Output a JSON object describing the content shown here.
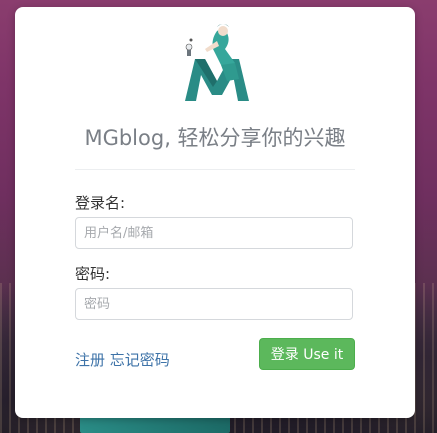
{
  "brand": {
    "tagline": "MGblog, 轻松分享你的兴趣"
  },
  "form": {
    "username_label": "登录名:",
    "username_placeholder": "用户名/邮箱",
    "username_value": "",
    "password_label": "密码:",
    "password_placeholder": "密码",
    "password_value": ""
  },
  "links": {
    "register": "注册",
    "forgot": "忘记密码"
  },
  "actions": {
    "login_label": "登录 Use it"
  },
  "colors": {
    "primary_button": "#5cb85c",
    "link": "#3e73a8",
    "logo_teal": "#2a8c86"
  },
  "icons": {
    "logo": "mgblog-logo-icon"
  }
}
